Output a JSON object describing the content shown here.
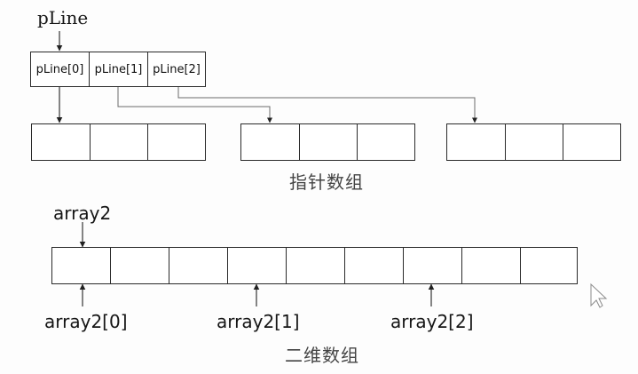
{
  "pointer_array": {
    "title": "pLine",
    "cells": [
      "pLine[0]",
      "pLine[1]",
      "pLine[2]"
    ],
    "caption": "指针数组"
  },
  "two_d_array": {
    "title": "array2",
    "labels": [
      "array2[0]",
      "array2[1]",
      "array2[2]"
    ],
    "caption": "二维数组"
  }
}
